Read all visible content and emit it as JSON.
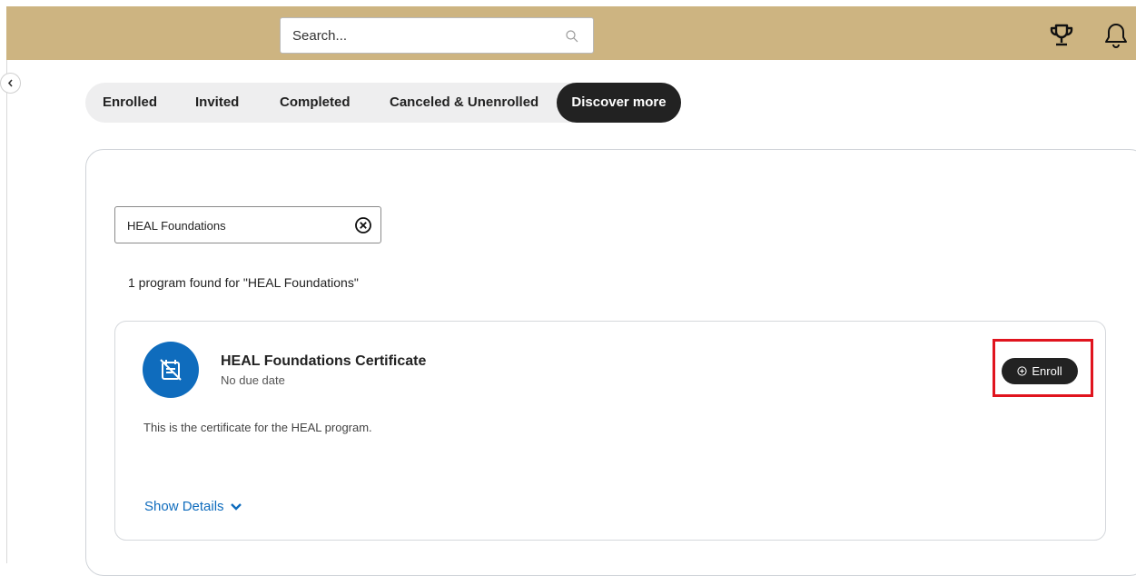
{
  "header": {
    "search_placeholder": "Search...",
    "search_icon": "search-icon",
    "trophy_icon": "trophy-icon",
    "bell_icon": "bell-icon",
    "background_color": "#cdb481"
  },
  "sidebar": {
    "toggle_icon": "chevron-left-icon"
  },
  "tabs": [
    {
      "label": "Enrolled",
      "active": false
    },
    {
      "label": "Invited",
      "active": false
    },
    {
      "label": "Completed",
      "active": false
    },
    {
      "label": "Canceled & Unenrolled",
      "active": false
    },
    {
      "label": "Discover more",
      "active": true
    }
  ],
  "filter": {
    "value": "HEAL Foundations",
    "clear_icon": "clear-circle-icon"
  },
  "results_text": "1 program found for \"HEAL Foundations\"",
  "program": {
    "icon": "certificate-icon",
    "title": "HEAL Foundations Certificate",
    "due": "No due date",
    "description": "This is the certificate for the HEAL program.",
    "enroll_label": "Enroll",
    "enroll_icon": "plus-circle-icon",
    "show_details_label": "Show Details",
    "show_details_icon": "chevron-down-icon"
  },
  "colors": {
    "accent": "#0f6cbd",
    "highlight": "#e0141e",
    "dark": "#222222"
  }
}
